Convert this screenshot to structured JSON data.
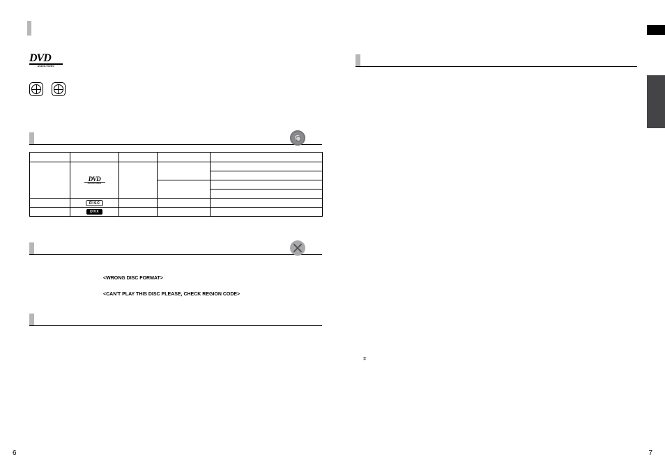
{
  "page_numbers": {
    "left": "6",
    "right": "7"
  },
  "dvd_logo": {
    "main": "DVD",
    "sub": "AUDIO/VIDEO"
  },
  "table": {
    "rows": {
      "dvd": {
        "logo_main": "DVD",
        "logo_sub": "AUDIO/VIDEO"
      },
      "cd": {
        "logo_text": "disc"
      },
      "divx": {
        "logo_text": "DIVX"
      }
    }
  },
  "error_messages": {
    "wrong_format": "<WRONG DISC FORMAT>",
    "region_code": "<CAN'T PLAY THIS DISC PLEASE, CHECK REGION CODE>"
  },
  "symbols": {
    "plus_minus": "±"
  }
}
